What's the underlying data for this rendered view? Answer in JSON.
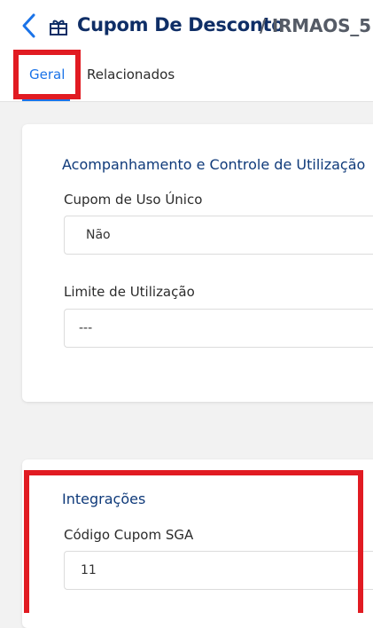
{
  "header": {
    "title": "Cupom De Desconto",
    "subtitle": "/ IRMAOS_5 -"
  },
  "tabs": [
    {
      "label": "Geral",
      "active": true
    },
    {
      "label": "Relacionados",
      "active": false
    }
  ],
  "section_usage": {
    "title": "Acompanhamento e Controle de Utilização",
    "fields": [
      {
        "label": "Cupom de Uso Único",
        "value": "Não"
      },
      {
        "label": "Limite de Utilização",
        "value": "---"
      }
    ]
  },
  "section_integrations": {
    "title": "Integrações",
    "fields": [
      {
        "label": "Código Cupom SGA",
        "value": "11"
      }
    ]
  },
  "colors": {
    "accent": "#1a73e8",
    "brand_title": "#0f2e66",
    "highlight": "#e11b22"
  },
  "icons": {
    "back": "chevron-left-icon",
    "title": "gift-icon"
  }
}
